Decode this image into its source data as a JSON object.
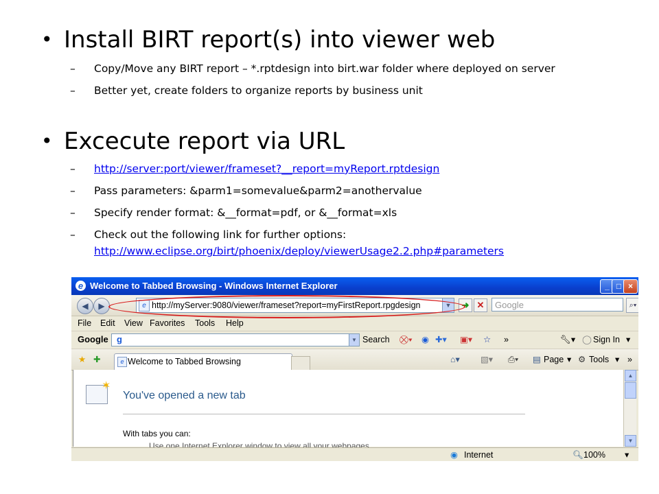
{
  "slide": {
    "bullet1": {
      "title": "Install BIRT report(s) into viewer web",
      "items": [
        "Copy/Move any BIRT report – *.rptdesign into birt.war folder where deployed on server",
        "Better yet, create folders to organize reports by business unit"
      ]
    },
    "bullet2": {
      "title": "Excecute report via URL",
      "link1": "http://server:port/viewer/frameset?__report=myReport.rptdesign",
      "item2": "Pass parameters: &parm1=somevalue&parm2=anothervalue",
      "item3": "Specify render format: &__format=pdf,  or &__format=xls",
      "item4": "Check out the following link for further options:",
      "link2": "http://www.eclipse.org/birt/phoenix/deploy/viewerUsage2.2.php#parameters"
    }
  },
  "browser": {
    "window_title": "Welcome to Tabbed Browsing - Windows Internet Explorer",
    "address": "http://myServer:9080/viewer/frameset?report=myFirstReport.rpgdesign",
    "search_placeholder": "Google",
    "menu": [
      "File",
      "Edit",
      "View",
      "Favorites",
      "Tools",
      "Help"
    ],
    "google_toolbar": {
      "logo": "Google",
      "g_button": "g",
      "search_label": "Search",
      "more": "»",
      "sign_in": "Sign In"
    },
    "tab_title": "Welcome to Tabbed Browsing",
    "command_bar": {
      "page": "Page",
      "tools": "Tools",
      "more": "»"
    },
    "content": {
      "heading": "You've opened a new tab",
      "subheading": "With tabs you can:",
      "clipped_line": "Use one Internet Explorer window to view all your webpages"
    },
    "status": {
      "zone": "Internet",
      "zoom": "100%"
    }
  },
  "colors": {
    "title_bar": "#0a4fe0",
    "link": "#0000ee",
    "annotation_oval": "#d81e1e",
    "heading_blue": "#2a5a8c"
  }
}
